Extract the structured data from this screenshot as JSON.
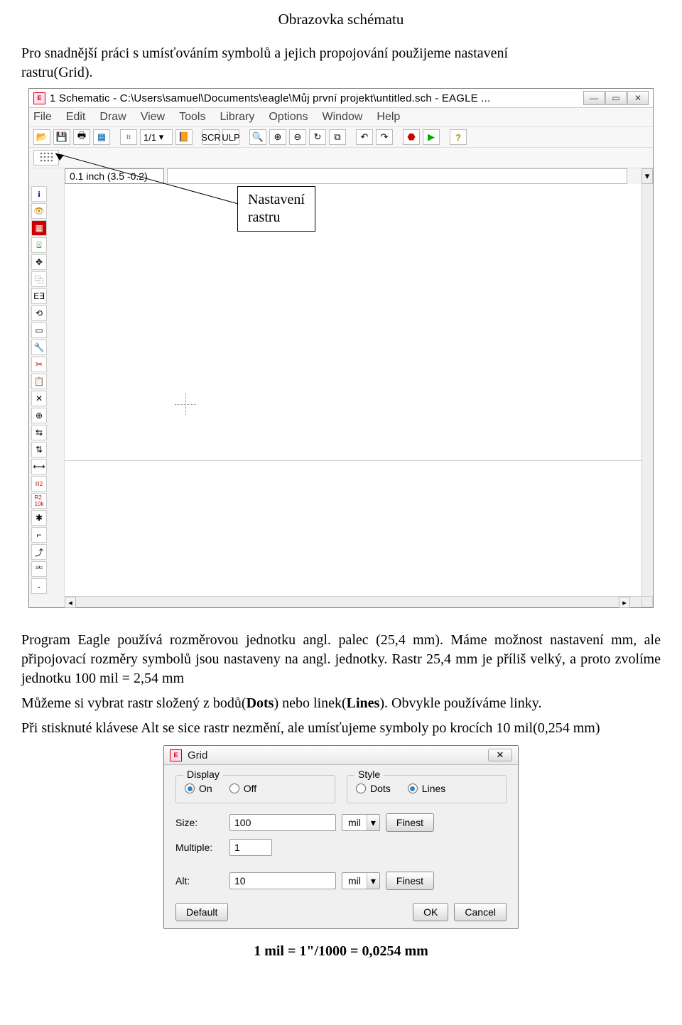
{
  "heading": "Obrazovka schématu",
  "intro_line1": "Pro snadnější práci s umísťováním symbolů a jejich propojování použijeme nastavení",
  "intro_line2": "rastru(Grid).",
  "eagle": {
    "title": "1 Schematic - C:\\Users\\samuel\\Documents\\eagle\\Můj první projekt\\untitled.sch - EAGLE ...",
    "menu": [
      "File",
      "Edit",
      "Draw",
      "View",
      "Tools",
      "Library",
      "Options",
      "Window",
      "Help"
    ],
    "sheet_combo": "1/1",
    "coord": "0.1 inch (3.5 -0.2)"
  },
  "annotation": {
    "line1": "Nastavení",
    "line2": "rastru"
  },
  "body1": "Program Eagle používá rozměrovou jednotku angl. palec (25,4 mm). Máme možnost nastavení  mm, ale připojovací rozměry symbolů jsou nastaveny na angl. jednotky. Rastr 25,4 mm je příliš velký, a proto zvolíme jednotku 100 mil = 2,54 mm",
  "body2_prefix": "Můžeme si vybrat rastr složený z bodů(",
  "body2_dots": "Dots",
  "body2_mid": ") nebo linek(",
  "body2_lines": "Lines",
  "body2_suffix": "). Obvykle používáme linky.",
  "body3": "Při stisknuté klávese Alt se sice rastr nezmění, ale umísťujeme symboly po krocích 10 mil(0,254 mm)",
  "grid_dialog": {
    "title": "Grid",
    "display_legend": "Display",
    "style_legend": "Style",
    "on": "On",
    "off": "Off",
    "dots": "Dots",
    "lines": "Lines",
    "size_label": "Size:",
    "size_value": "100",
    "unit": "mil",
    "finest": "Finest",
    "multiple_label": "Multiple:",
    "multiple_value": "1",
    "alt_label": "Alt:",
    "alt_value": "10",
    "default": "Default",
    "ok": "OK",
    "cancel": "Cancel"
  },
  "footnote": "1 mil = 1\"/1000 = 0,0254 mm"
}
